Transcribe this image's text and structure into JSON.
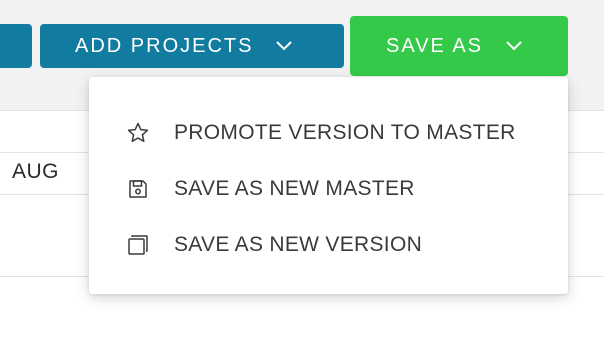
{
  "toolbar": {
    "add_projects_label": "ADD PROJECTS",
    "save_as_label": "SAVE AS"
  },
  "table": {
    "column_header": "AUG"
  },
  "save_menu": {
    "items": [
      {
        "label": "PROMOTE VERSION TO MASTER",
        "icon": "star-icon"
      },
      {
        "label": "SAVE AS NEW MASTER",
        "icon": "floppy-disk-icon"
      },
      {
        "label": "SAVE AS NEW VERSION",
        "icon": "copy-icon"
      }
    ]
  },
  "colors": {
    "primary_blue": "#127ba0",
    "save_green": "#35c94a",
    "band_gray": "#f2f2f2"
  }
}
